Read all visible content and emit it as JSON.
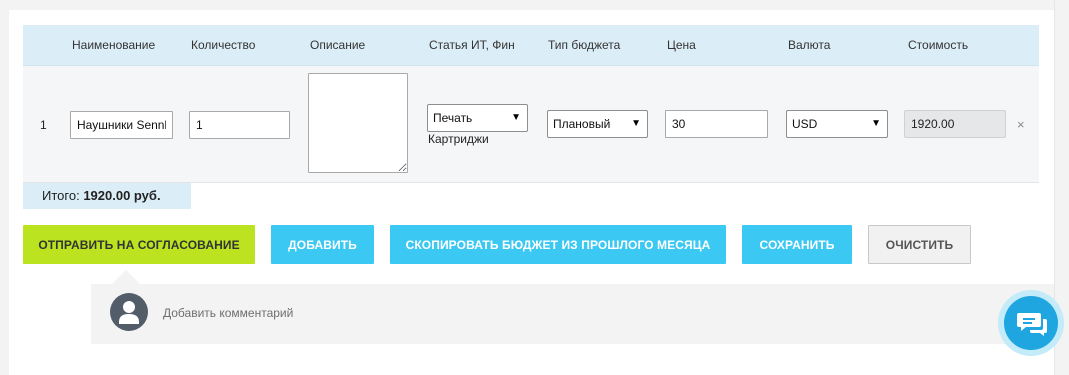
{
  "table": {
    "headers": {
      "name": "Наименование",
      "quantity": "Количество",
      "description": "Описание",
      "article": "Статья ИТ, Фин",
      "budget_type": "Тип бюджета",
      "price": "Цена",
      "currency": "Валюта",
      "cost": "Стоимость"
    },
    "row": {
      "number": "1",
      "name_value": "Наушники Sennl",
      "quantity_value": "1",
      "description_value": "",
      "article_selected": "Печать",
      "article_sub": "Картриджи",
      "budget_type_selected": "Плановый",
      "price_value": "30",
      "currency_selected": "USD",
      "cost_value": "1920.00",
      "remove_symbol": "×"
    }
  },
  "total": {
    "label": "Итого:",
    "value": "1920.00 руб."
  },
  "buttons": {
    "send": "Отправить на согласование",
    "add": "Добавить",
    "copy": "Скопировать бюджет из прошлого месяца",
    "save": "Сохранить",
    "clear": "Очистить"
  },
  "comments": {
    "placeholder": "Добавить комментарий"
  },
  "colors": {
    "header_bg": "#dbeef7",
    "send_button": "#bbe31f",
    "blue_button": "#3bc8f3",
    "chat_button": "#1fa6e1",
    "avatar": "#535c69"
  },
  "icons": {
    "dropdown": "caret-down-icon",
    "remove": "close-icon",
    "avatar": "user-silhouette-icon",
    "chat": "chat-bubbles-icon"
  }
}
